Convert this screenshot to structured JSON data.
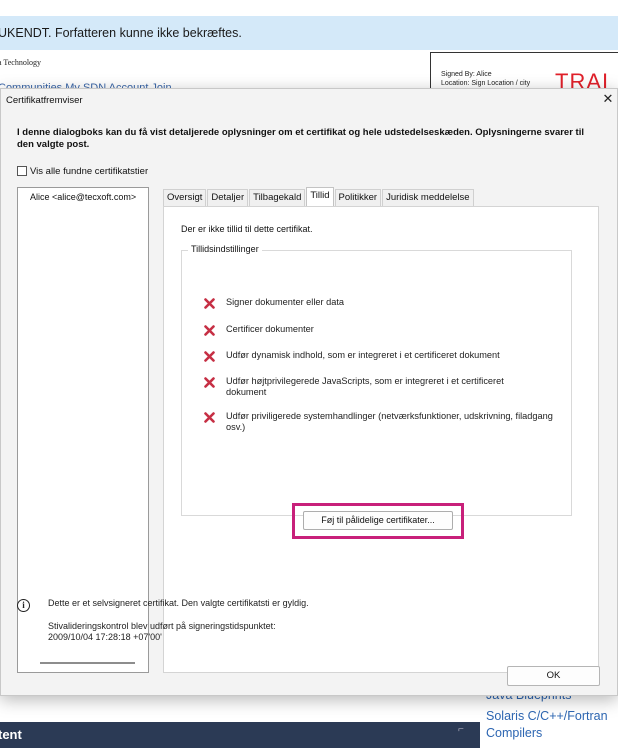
{
  "background": {
    "banner_text": "UKENDT. Forfatteren kunne ikke bekræftes.",
    "logo_text": "a Technology",
    "nav_text": "Communities  My SDN Account  Join",
    "signature": {
      "signed_by": "Signed By: Alice",
      "location": "Location: Sign Location / city",
      "watermark": "TRAI"
    },
    "bottom_bar_text": "tent",
    "sidebar_links": [
      "Java Blueprints",
      "Solaris C/C++/Fortran",
      "Compilers"
    ]
  },
  "dialog": {
    "title": "Certifikatfremviser",
    "close_glyph": "✕",
    "description": "I denne dialogboks kan du få vist detaljerede oplysninger om et certifikat og hele udstedelseskæden. Oplysningerne svarer til den valgte post.",
    "show_all_label": "Vis alle fundne certifikatstier",
    "show_all_checked": false,
    "tree_items": [
      "Alice <alice@tecxoft.com>"
    ],
    "tabs": [
      {
        "label": "Oversigt",
        "active": false
      },
      {
        "label": "Detaljer",
        "active": false
      },
      {
        "label": "Tilbagekald",
        "active": false
      },
      {
        "label": "Tillid",
        "active": true
      },
      {
        "label": "Politikker",
        "active": false
      },
      {
        "label": "Juridisk meddelelse",
        "active": false
      }
    ],
    "trust_tab": {
      "status": "Der er ikke tillid til dette certifikat.",
      "group_title": "Tillidsindstillinger",
      "items": [
        "Signer dokumenter eller data",
        "Certificer dokumenter",
        "Udfør dynamisk indhold, som er integreret i et certificeret dokument",
        "Udfør højtprivilegerede JavaScripts, som er integreret i et certificeret dokument",
        "Udfør priviligerede systemhandlinger (netværksfunktioner, udskrivning, filadgang osv.)"
      ],
      "add_button": "Føj til pålidelige certifikater..."
    },
    "info_icon": "i",
    "info_text": "Dette er et selvsigneret certifikat. Den valgte certifikatsti er gyldig.",
    "validation_line1": "Stivalideringskontrol blev udført på signeringstidspunktet:",
    "validation_line2": "2009/10/04 17:28:18 +07'00'",
    "ok_button": "OK"
  },
  "colors": {
    "banner_bg": "#d4e9f9",
    "highlight_border": "#c8207a",
    "x_icon": "#c62f44",
    "watermark": "#e0202a"
  }
}
